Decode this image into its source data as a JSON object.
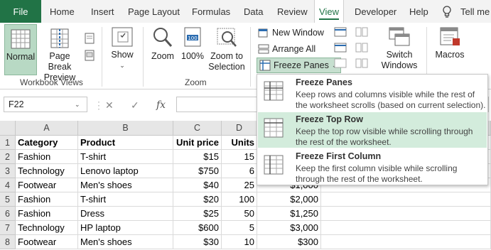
{
  "tabs": {
    "file": "File",
    "items": [
      "Home",
      "Insert",
      "Page Layout",
      "Formulas",
      "Data",
      "Review",
      "View",
      "Developer",
      "Help"
    ],
    "active": "View",
    "tell_me": "Tell me"
  },
  "ribbon": {
    "normal": "Normal",
    "page_break_1": "Page Break",
    "page_break_2": "Preview",
    "workbook_views": "Workbook Views",
    "show": "Show",
    "zoom": "Zoom",
    "zoom100": "100%",
    "zoom_sel_1": "Zoom to",
    "zoom_sel_2": "Selection",
    "zoom_group": "Zoom",
    "new_window": "New Window",
    "arrange_all": "Arrange All",
    "freeze_panes": "Freeze Panes",
    "switch_1": "Switch",
    "switch_2": "Windows",
    "macros": "Macros"
  },
  "formula_bar": {
    "name_box": "F22",
    "fx": "fx"
  },
  "columns": [
    "A",
    "B",
    "C",
    "D"
  ],
  "rows": [
    {
      "n": "1",
      "a": "Category",
      "b": "Product",
      "c": "Unit price",
      "d": "Units",
      "e": ""
    },
    {
      "n": "2",
      "a": "Fashion",
      "b": "T-shirt",
      "c": "$15",
      "d": "15",
      "e": ""
    },
    {
      "n": "3",
      "a": "Technology",
      "b": "Lenovo laptop",
      "c": "$750",
      "d": "6",
      "e": ""
    },
    {
      "n": "4",
      "a": "Footwear",
      "b": "Men's shoes",
      "c": "$40",
      "d": "25",
      "e": "$1,000"
    },
    {
      "n": "5",
      "a": "Fashion",
      "b": "T-shirt",
      "c": "$20",
      "d": "100",
      "e": "$2,000"
    },
    {
      "n": "6",
      "a": "Fashion",
      "b": "Dress",
      "c": "$25",
      "d": "50",
      "e": "$1,250"
    },
    {
      "n": "7",
      "a": "Technology",
      "b": "HP laptop",
      "c": "$600",
      "d": "5",
      "e": "$3,000"
    },
    {
      "n": "8",
      "a": "Footwear",
      "b": "Men's shoes",
      "c": "$30",
      "d": "10",
      "e": "$300"
    }
  ],
  "dropdown": [
    {
      "title": "Freeze Panes",
      "desc": "Keep rows and columns visible while the rest of the worksheet scrolls (based on current selection)."
    },
    {
      "title": "Freeze Top Row",
      "desc": "Keep the top row visible while scrolling through the rest of the worksheet."
    },
    {
      "title": "Freeze First Column",
      "desc": "Keep the first column visible while scrolling through the rest of the worksheet."
    }
  ],
  "colors": {
    "accent": "#217346",
    "hover": "#d3ecdc"
  }
}
